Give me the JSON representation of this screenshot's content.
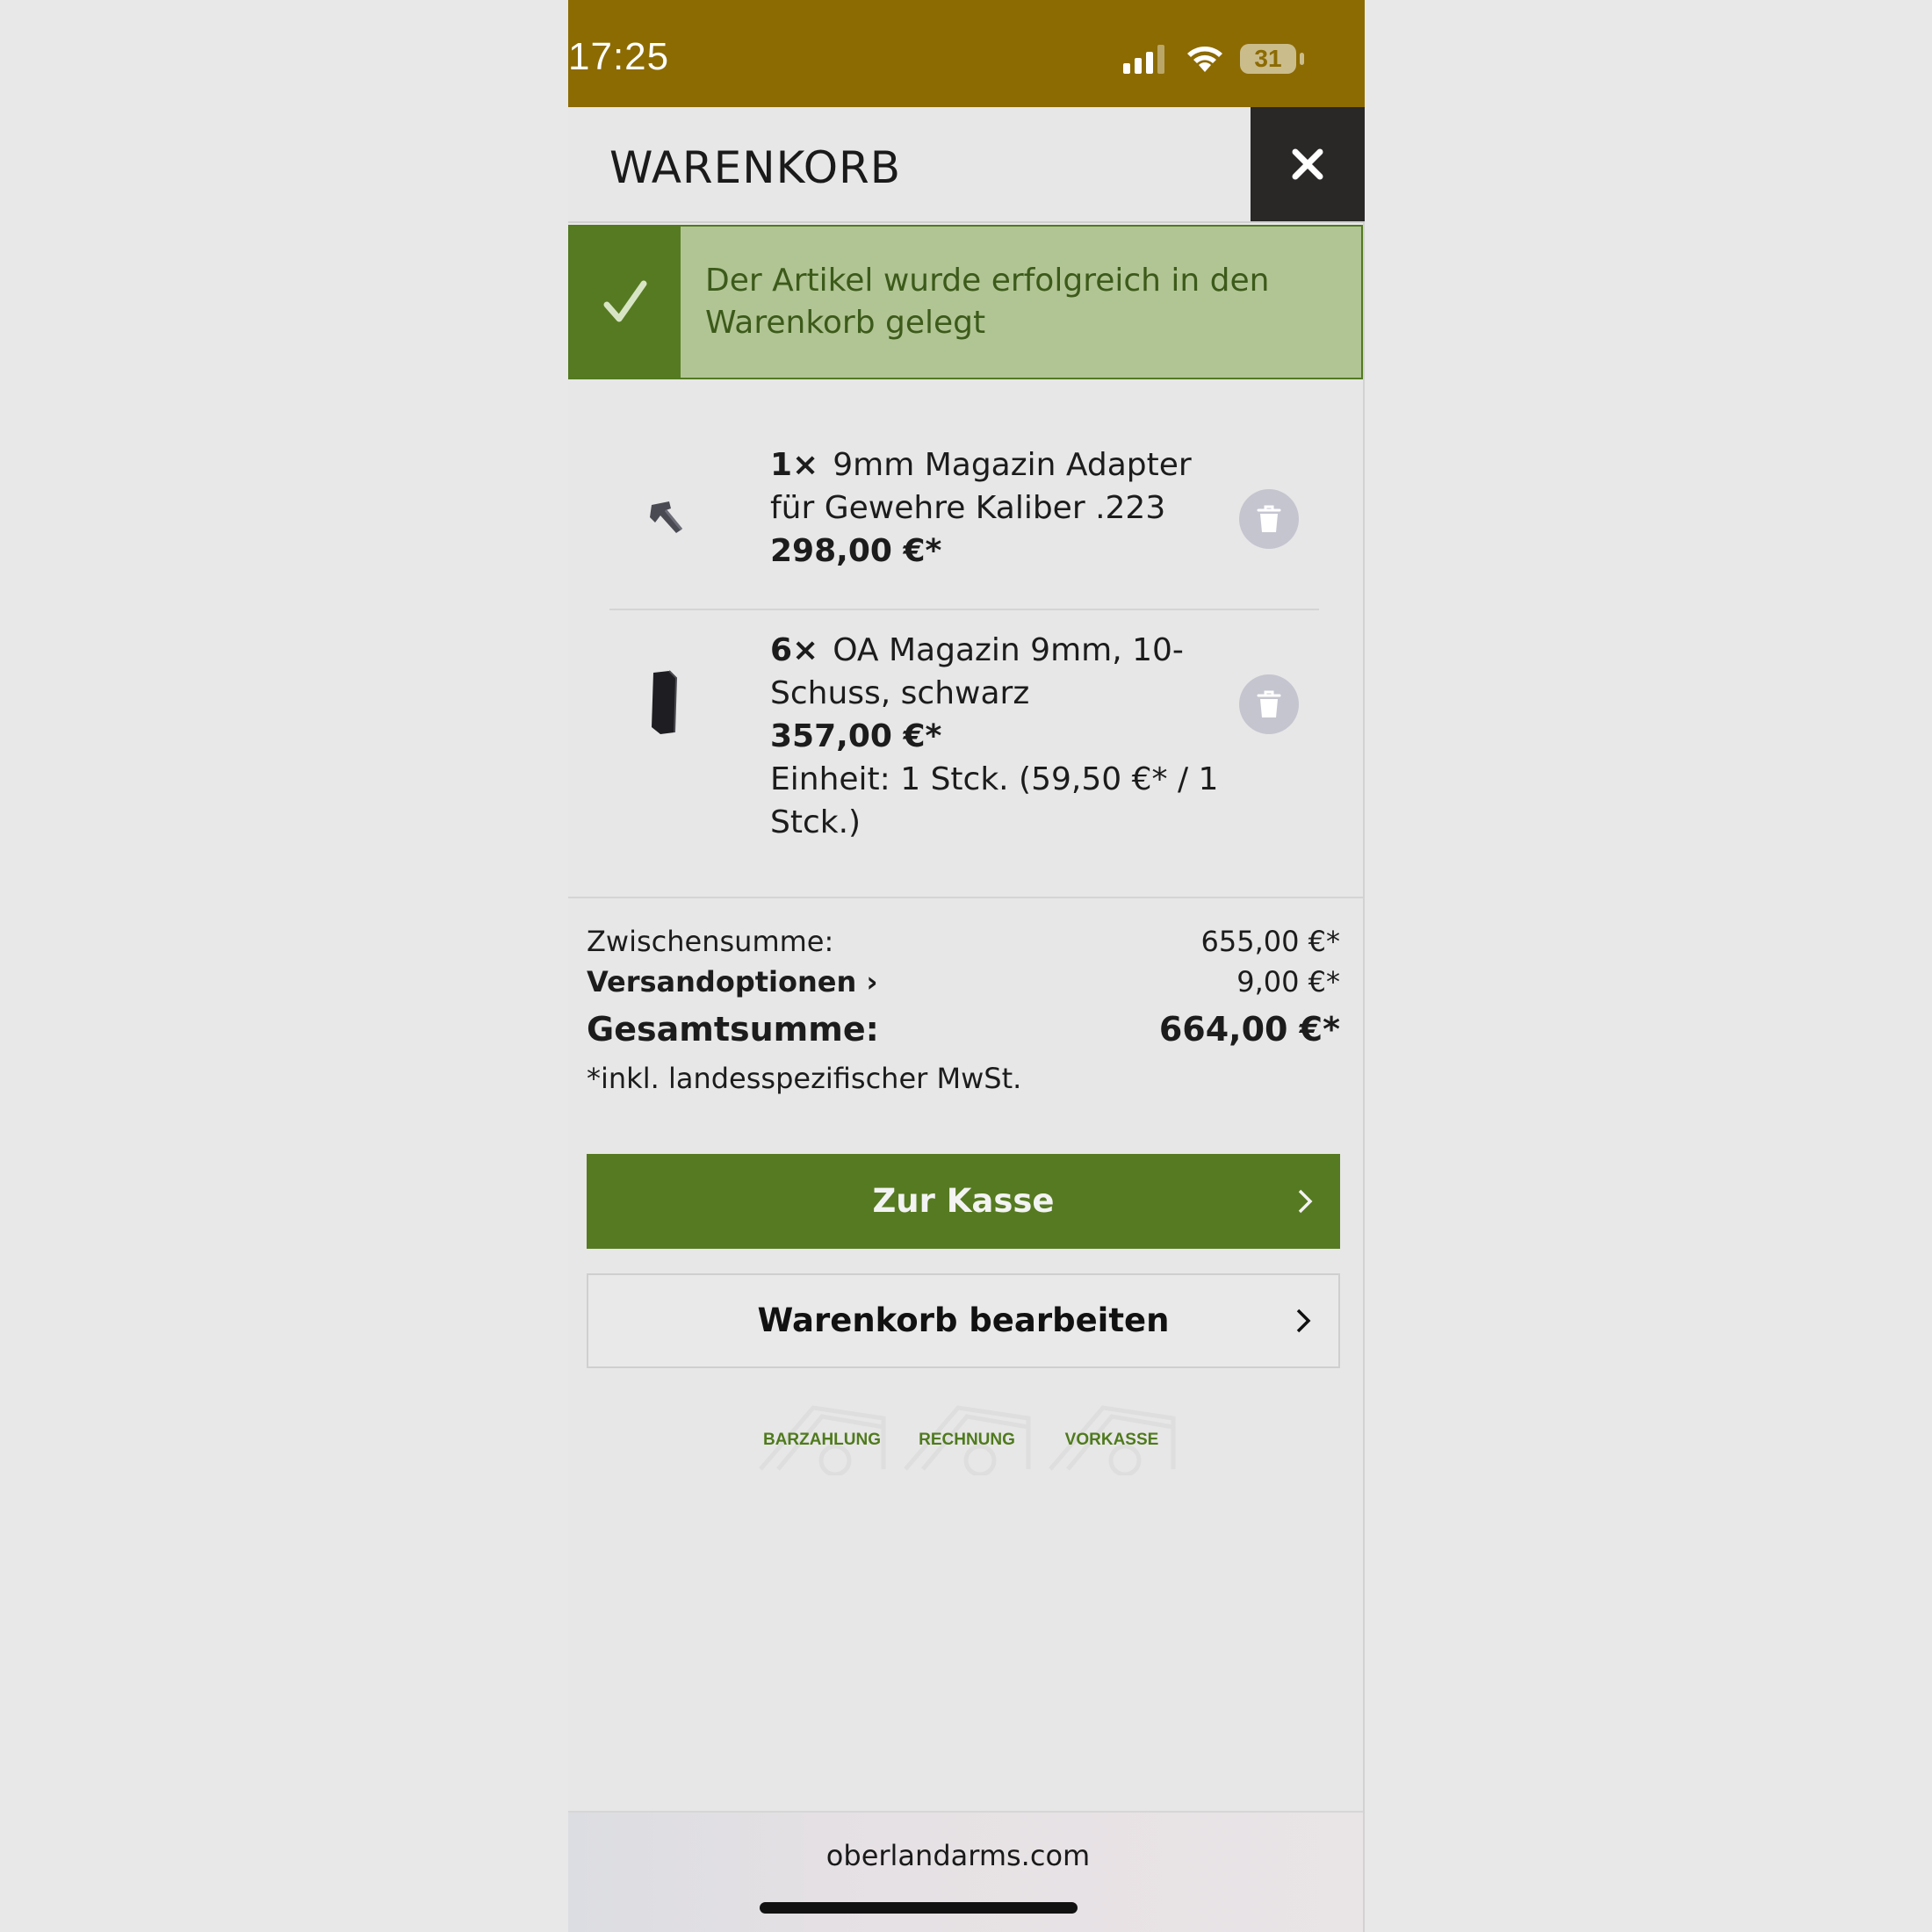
{
  "status_bar": {
    "time": "17:25",
    "battery": "31"
  },
  "header": {
    "title": "WARENKORB",
    "close_icon": "close-icon"
  },
  "success": {
    "message": "Der Artikel wurde erfolgreich in den Warenkorb gelegt"
  },
  "items": [
    {
      "qty": "1×",
      "name": "9mm Magazin Adapter für Gewehre Kaliber .223",
      "price": "298,00 €*",
      "unit": ""
    },
    {
      "qty": "6×",
      "name": "OA Magazin 9mm, 10-Schuss, schwarz",
      "price": "357,00 €*",
      "unit": "Einheit: 1 Stck. (59,50 €* / 1 Stck.)"
    }
  ],
  "summary": {
    "subtotal_label": "Zwischensumme:",
    "subtotal_value": "655,00 €*",
    "shipping_label": "Versandoptionen",
    "shipping_value": "9,00 €*",
    "total_label": "Gesamtsumme:",
    "total_value": "664,00 €*",
    "tax_note": "*inkl. landesspezifischer MwSt."
  },
  "buttons": {
    "checkout": "Zur Kasse",
    "edit_cart": "Warenkorb bearbeiten"
  },
  "payment_methods": [
    "BARZAHLUNG",
    "RECHNUNG",
    "VORKASSE"
  ],
  "footer": {
    "url": "oberlandarms.com"
  },
  "colors": {
    "status_bar": "#8c6b02",
    "brand_green": "#567a21",
    "success_bg": "#b1c594"
  }
}
